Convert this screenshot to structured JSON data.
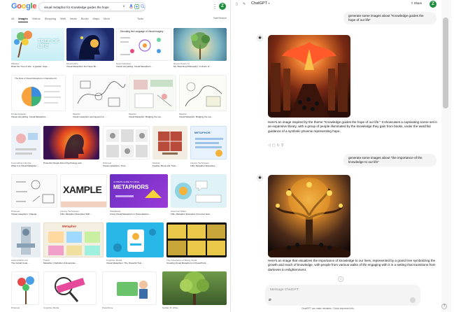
{
  "google": {
    "logo": [
      "G",
      "o",
      "o",
      "g",
      "l",
      "e"
    ],
    "query": "visual metaphor for Knowledge guides the hope",
    "tabs": [
      "All",
      "Images",
      "Videos",
      "Shopping",
      "Web",
      "News",
      "Books",
      "Maps"
    ],
    "more": "More",
    "tools": "Tools",
    "safe": "SafeSearch",
    "avatar": "Z",
    "results": [
      {
        "src": "Wikihow",
        "title": "Draw the Tree of Life : a guided, hope ..."
      },
      {
        "src": "Dreamstime",
        "title": "Visual Metaphors For Hope Sh..."
      },
      {
        "src": "Kevin Daydeep",
        "title": "Visual storytelling: Visual Metaphors ..."
      },
      {
        "src": "Dream Poetry AI",
        "title": "My 'Reaching Philosophy': A Vision of ..."
      },
      {
        "src": "ProductCaptain",
        "title": "Visual storytelling: Visual Metaphors ..."
      },
      {
        "src": "Medium",
        "title": "Visual metaphors and layouts for ..."
      },
      {
        "src": "Medium",
        "title": "Visual Metaphor: Bridging the Ga..."
      },
      {
        "src": "Medium",
        "title": "Visual Metaphor: Bridging the Ga..."
      },
      {
        "src": "Formulating Lifestyle",
        "title": "What Is A Visual Metaphor ..."
      },
      {
        "src": "",
        "title": "Powerful Visuals About Psychology and ..."
      },
      {
        "src": "Pinterest",
        "title": "Visual metaphors: Trust"
      },
      {
        "src": "Medium",
        "title": "Feather, Book and Trust..."
      },
      {
        "src": "Literary Techniques",
        "title": "100+ Metaphor Examples ..."
      },
      {
        "src": "Pinterest",
        "title": "Visual metaphors: Change"
      },
      {
        "src": "Literary Techniques",
        "title": "100+ Metaphor Examples With ..."
      },
      {
        "src": "SlideModel",
        "title": "Using Visual Metaphors in Presentations ..."
      },
      {
        "src": "Grammar Slides",
        "title": "100+ Metaphor Examples (Common Eve..."
      },
      {
        "src": "www.SoSDA.com",
        "title": "The Cobalt Code ..."
      },
      {
        "src": "Twinkl",
        "title": "Metaphor | Definition & Examples ..."
      },
      {
        "src": "Cognitive Media",
        "title": "Visual Metaphors: The Powerful Tool ..."
      },
      {
        "src": "The Importance of Being Visual",
        "title": "Creating Visual Metaphors in PowerPoint ..."
      },
      {
        "src": "Pinterest",
        "title": ""
      },
      {
        "src": "Cognitive Media",
        "title": ""
      },
      {
        "src": "PaperRose",
        "title": ""
      },
      {
        "src": "Nathan R. White",
        "title": ""
      }
    ],
    "tile_texts": {
      "tree": "TREE OF LIFE",
      "vis_title": "Decoding the Language of Visual Imagery",
      "narrative": "The Role of Visual Metaphors in Narrative Art",
      "xample": "XAMPLE",
      "metaphors": "METAPHORS",
      "metaphors_pre": "ULTIMATE GUIDE TO USING",
      "metaphor_small": "METAPHOR",
      "metaphor_card": "Metaphor"
    }
  },
  "chat": {
    "title": "ChatGPT",
    "share": "Share",
    "avatar": "Z",
    "u1": "generate some images about \"Knowledge guides the hope of our life\"",
    "a1": "Here's an image inspired by the theme \"Knowledge guides the hope of our life.\" It showcases a captivating scene set in an expansive library, with a group of people illuminated by the knowledge they gain from books, under the watchful guidance of a symbolic phoenix representing hope.",
    "u2": "generate some images about \"the importance of the knowledge to our life\"",
    "a2": "Here's an image that visualizes the importance of knowledge to our lives, represented by a grand tree symbolizing the growth and reach of knowledge, with people from various walks of life engaging with it in a setting that transitions from darkness to enlightenment.",
    "placeholder": "Message ChatGPT",
    "disclaimer": "ChatGPT can make mistakes. Check important info.",
    "help": "?"
  },
  "colors": {
    "accent_green": "#1e8e3e",
    "bubble": "#f4f4f4"
  }
}
